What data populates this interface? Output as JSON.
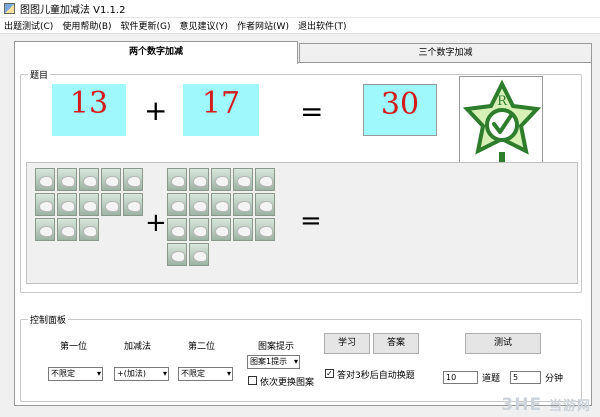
{
  "window": {
    "title": "图图儿童加减法 V1.1.2"
  },
  "menu": [
    "出题测试(C)",
    "使用帮助(B)",
    "软件更新(G)",
    "意见建议(Y)",
    "作者网站(W)",
    "退出软件(T)"
  ],
  "tabs": [
    {
      "label": "两个数字加减"
    },
    {
      "label": "三个数字加减"
    }
  ],
  "question": {
    "group_label": "题目",
    "first_number": "13",
    "operator": "+",
    "second_number": "17",
    "equals": "=",
    "answer": "30",
    "first_picture_count": 13,
    "second_picture_count": 17,
    "badge_letter": "R"
  },
  "controls": {
    "group_label": "控制面板",
    "labels": {
      "first": "第一位",
      "op": "加减法",
      "second": "第二位",
      "hint": "图案提示"
    },
    "selects": {
      "first": "不限定",
      "op": "+(加法)",
      "second": "不限定",
      "hint": "图案1提示"
    },
    "checkboxes": {
      "change_picture": "依次更换图案",
      "auto_next": "答对3秒后自动换题"
    },
    "buttons": {
      "study": "学习",
      "answer": "答案",
      "test": "测试"
    },
    "test": {
      "count": "10",
      "count_unit": "道题",
      "minutes": "5",
      "minutes_unit": "分钟"
    }
  },
  "watermark": {
    "brand": "3HE",
    "site": "当游网"
  },
  "colors": {
    "number_bg": "#9ff8fb",
    "number_text": "#d41b1b",
    "badge_green": "#2d7d2c",
    "badge_pale": "#d7f0b5"
  }
}
